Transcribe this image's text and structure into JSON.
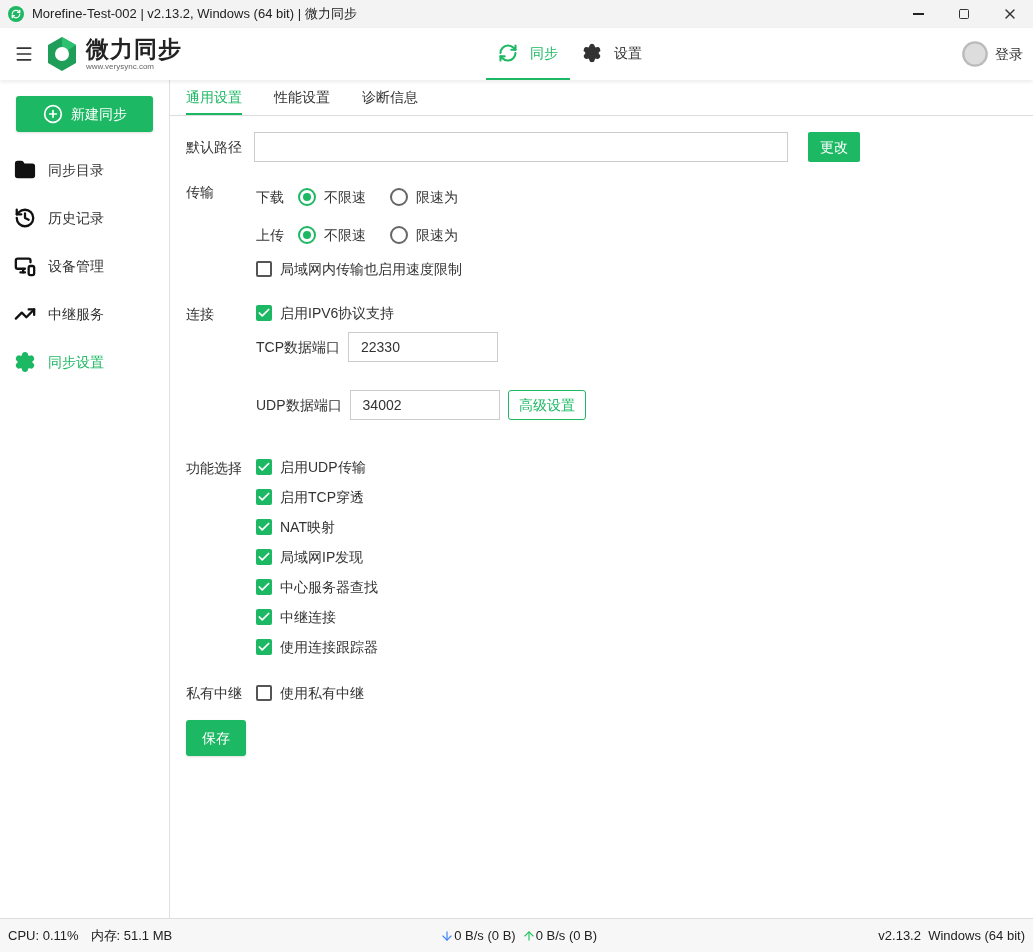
{
  "window": {
    "title": "Morefine-Test-002 | v2.13.2, Windows (64 bit) | 微力同步"
  },
  "header": {
    "logo_text": "微力同步",
    "logo_url": "www.verysync.com",
    "nav": [
      {
        "label": "同步",
        "kind": "sync",
        "selected": true
      },
      {
        "label": "设置",
        "kind": "gear",
        "selected": false
      }
    ],
    "login": "登录"
  },
  "sidebar": {
    "new_button": "新建同步",
    "items": [
      {
        "label": "同步目录",
        "kind": "folder",
        "selected": false
      },
      {
        "label": "历史记录",
        "kind": "history",
        "selected": false
      },
      {
        "label": "设备管理",
        "kind": "devices",
        "selected": false
      },
      {
        "label": "中继服务",
        "kind": "trend",
        "selected": false
      },
      {
        "label": "同步设置",
        "kind": "gear",
        "selected": true
      }
    ]
  },
  "tabs": [
    {
      "label": "通用设置",
      "selected": true
    },
    {
      "label": "性能设置",
      "selected": false
    },
    {
      "label": "诊断信息",
      "selected": false
    }
  ],
  "default_path": {
    "label": "默认路径",
    "button": "更改"
  },
  "transfer": {
    "label": "传输",
    "rows": [
      {
        "label": "下载",
        "options": [
          {
            "label": "不限速",
            "selected": true
          },
          {
            "label": "限速为",
            "selected": false
          }
        ]
      },
      {
        "label": "上传",
        "options": [
          {
            "label": "不限速",
            "selected": true
          },
          {
            "label": "限速为",
            "selected": false
          }
        ]
      }
    ],
    "lan_limit": {
      "label": "局域网内传输也启用速度限制",
      "checked": false
    }
  },
  "connection": {
    "label": "连接",
    "ipv6": {
      "label": "启用IPV6协议支持",
      "checked": true
    },
    "tcp_port": {
      "label": "TCP数据端口",
      "value": "22330"
    },
    "udp_port": {
      "label": "UDP数据端口",
      "value": "34002"
    },
    "advanced_button": "高级设置"
  },
  "features": {
    "label": "功能选择",
    "items": [
      {
        "label": "启用UDP传输",
        "checked": true
      },
      {
        "label": "启用TCP穿透",
        "checked": true
      },
      {
        "label": "NAT映射",
        "checked": true
      },
      {
        "label": "局域网IP发现",
        "checked": true
      },
      {
        "label": "中心服务器查找",
        "checked": true
      },
      {
        "label": "中继连接",
        "checked": true
      },
      {
        "label": "使用连接跟踪器",
        "checked": true
      }
    ]
  },
  "private_relay": {
    "label": "私有中继",
    "option": {
      "label": "使用私有中继",
      "checked": false
    }
  },
  "save_button": "保存",
  "status_bar": {
    "cpu": "CPU: 0.11%",
    "memory": "内存: 51.1 MB",
    "download": "0 B/s (0 B)",
    "upload": "0 B/s (0 B)",
    "version": "v2.13.2  Windows (64 bit)"
  }
}
